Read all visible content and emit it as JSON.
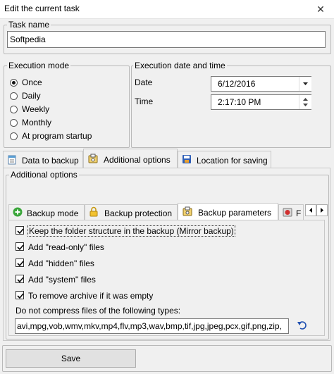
{
  "window": {
    "title": "Edit the current task",
    "close_glyph": "✕"
  },
  "task_name": {
    "label": "Task name",
    "value": "Softpedia"
  },
  "execution_mode": {
    "label": "Execution mode",
    "options": [
      "Once",
      "Daily",
      "Weekly",
      "Monthly",
      "At program startup"
    ],
    "selected": "Once"
  },
  "execution_datetime": {
    "label": "Execution date and time",
    "date_label": "Date",
    "date_value": "6/12/2016",
    "time_label": "Time",
    "time_value": "2:17:10 PM"
  },
  "main_tabs": [
    {
      "label": "Data to backup",
      "icon": "document-icon"
    },
    {
      "label": "Additional options",
      "icon": "options-icon",
      "active": true
    },
    {
      "label": "Location for saving",
      "icon": "disk-icon"
    }
  ],
  "additional_options": {
    "label": "Additional options",
    "sub_tabs": [
      {
        "label": "Backup mode",
        "icon": "green-plus-icon"
      },
      {
        "label": "Backup protection",
        "icon": "lock-icon"
      },
      {
        "label": "Backup parameters",
        "icon": "parameters-icon",
        "active": true
      },
      {
        "label": "F",
        "icon": "red-icon"
      }
    ],
    "checkboxes": [
      {
        "label": "Keep the folder structure in the backup (Mirror backup)",
        "checked": true
      },
      {
        "label": "Add \"read-only\" files",
        "checked": true
      },
      {
        "label": "Add \"hidden\" files",
        "checked": true
      },
      {
        "label": "Add \"system\" files",
        "checked": true
      },
      {
        "label": "To remove archive if it was empty",
        "checked": true
      }
    ],
    "compress_label": "Do not compress files of the following types:",
    "compress_value": "avi,mpg,vob,wmv,mkv,mp4,flv,mp3,wav,bmp,tif,jpg,jpeg,pcx,gif,png,zip,"
  },
  "save_button": "Save"
}
